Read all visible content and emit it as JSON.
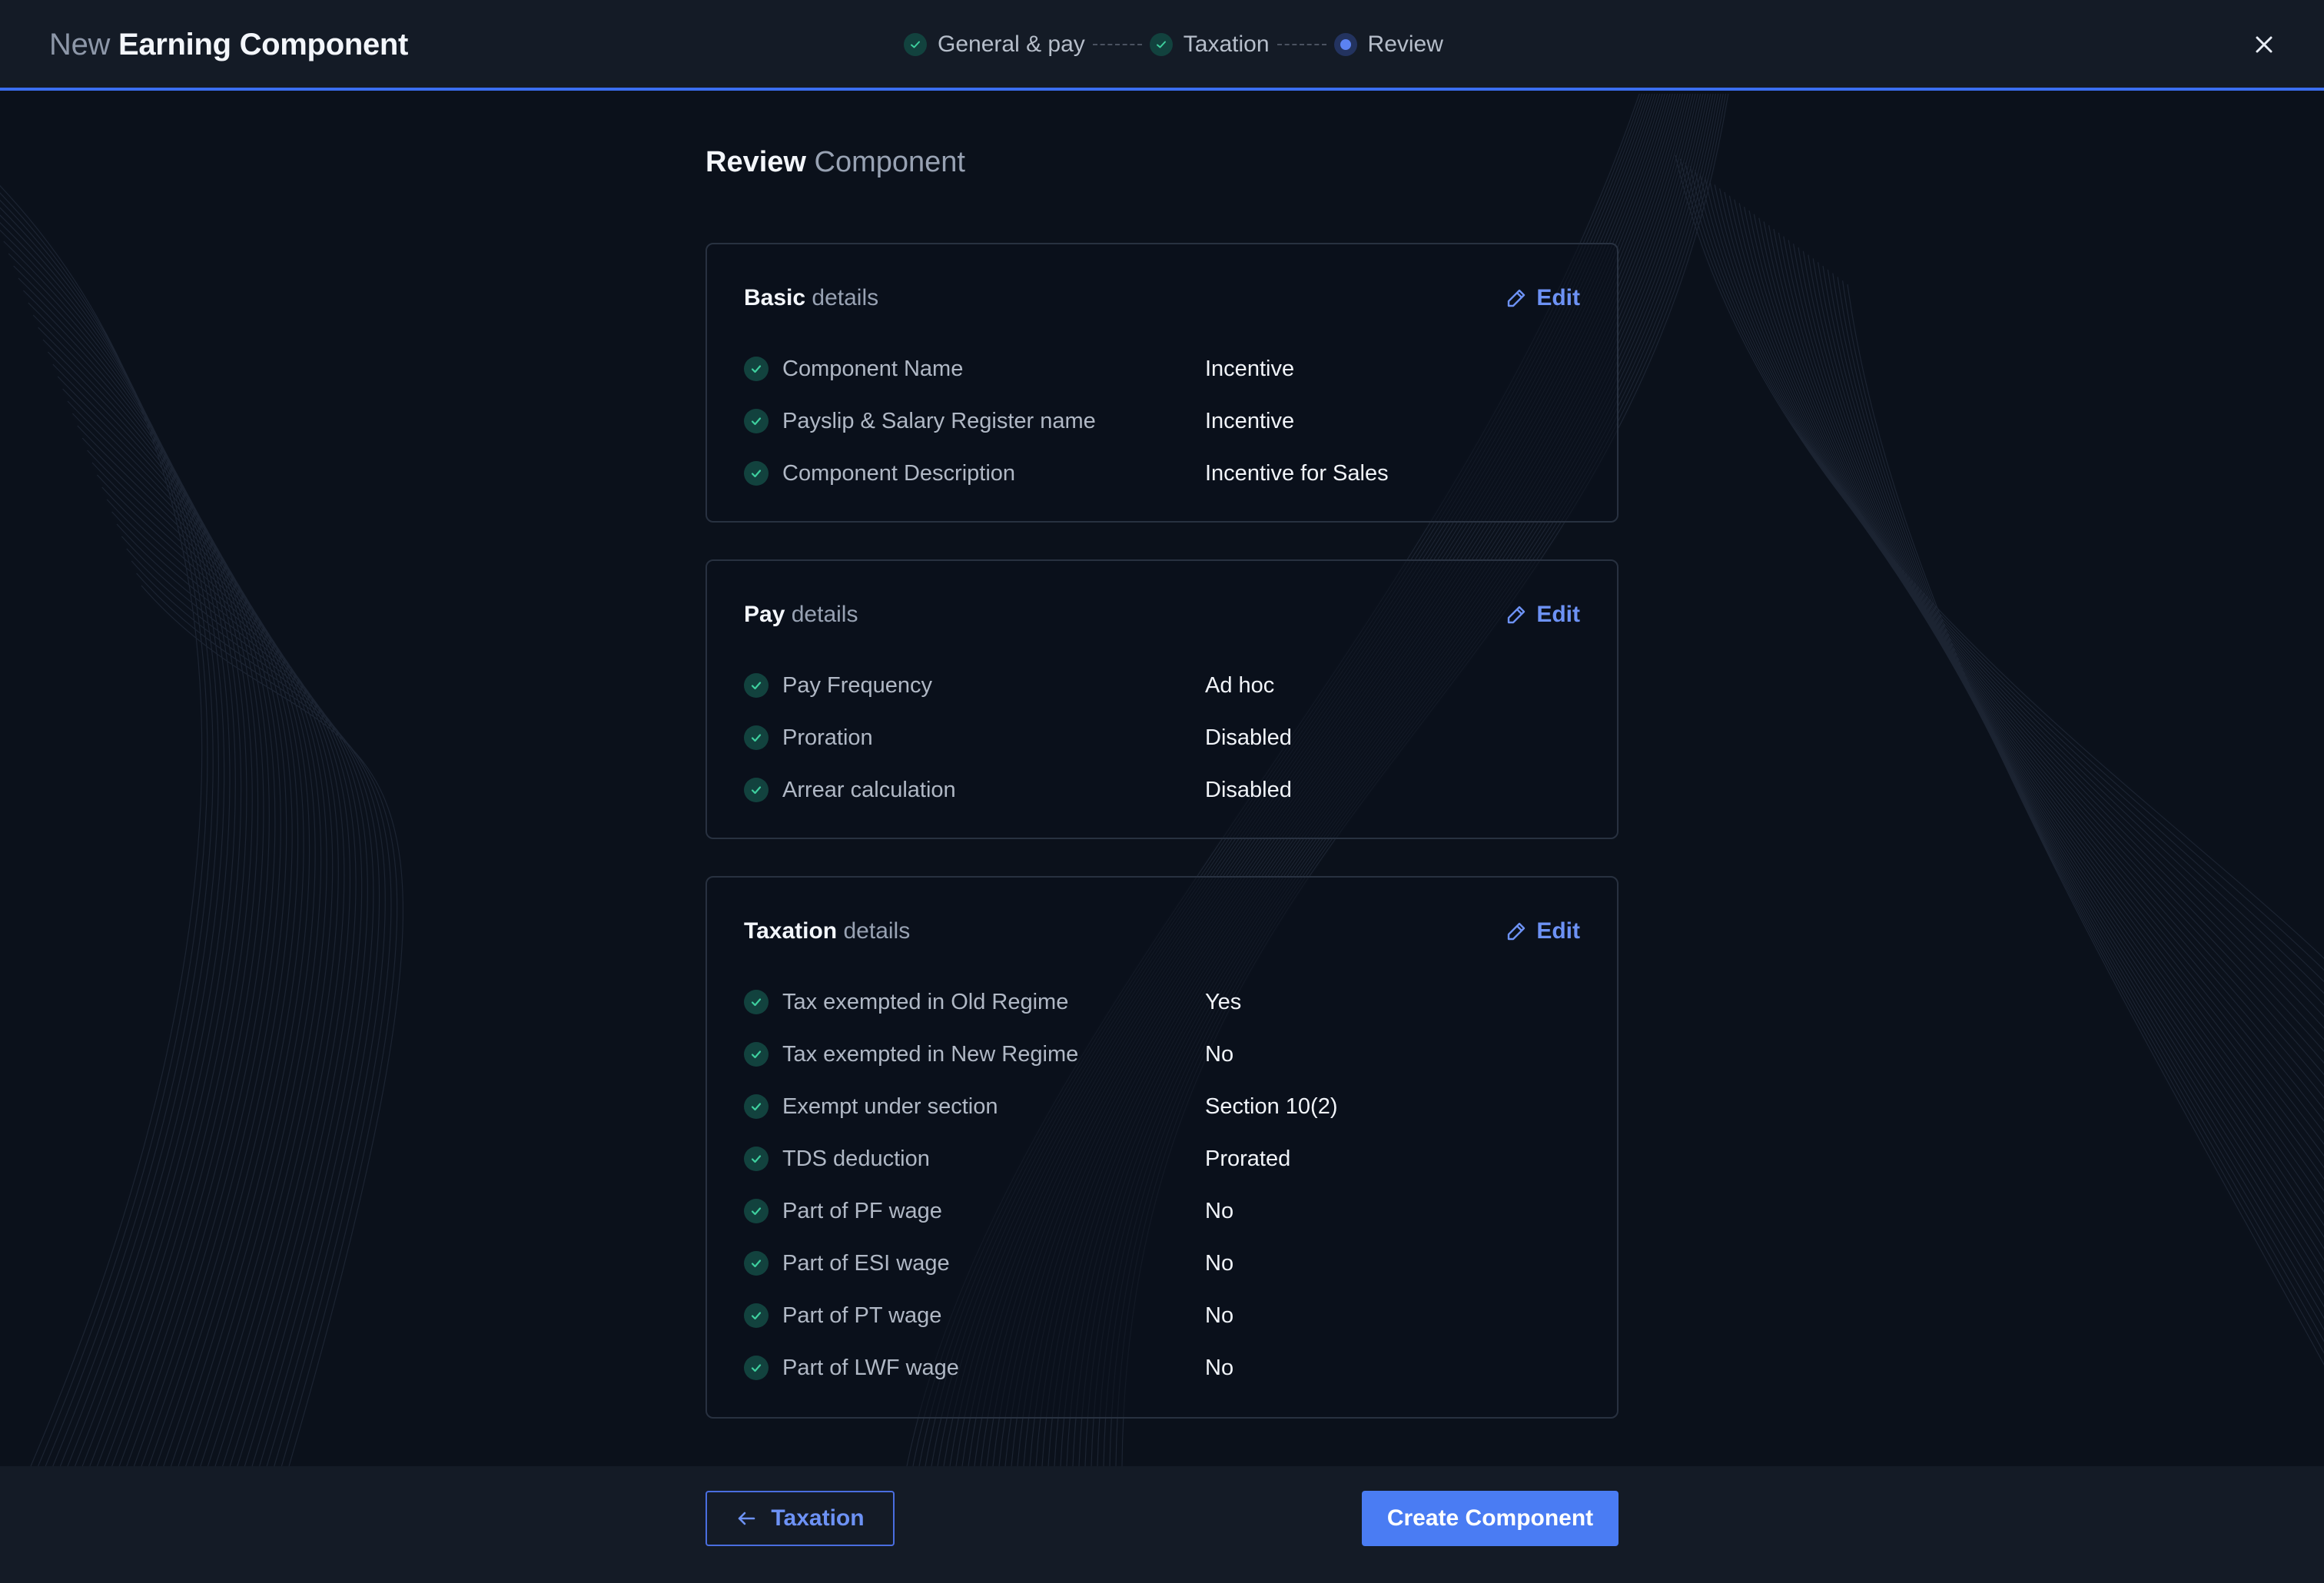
{
  "header": {
    "title_prefix": "New",
    "title_main": "Earning Component",
    "steps": [
      {
        "label": "General & pay",
        "status": "complete"
      },
      {
        "label": "Taxation",
        "status": "complete"
      },
      {
        "label": "Review",
        "status": "current"
      }
    ],
    "close_icon": "close-icon"
  },
  "page": {
    "heading_bold": "Review",
    "heading_light": "Component"
  },
  "sections": [
    {
      "title_bold": "Basic",
      "title_light": "details",
      "edit_label": "Edit",
      "rows": [
        {
          "label": "Component Name",
          "value": "Incentive"
        },
        {
          "label": "Payslip & Salary Register name",
          "value": "Incentive"
        },
        {
          "label": "Component Description",
          "value": "Incentive for Sales"
        }
      ]
    },
    {
      "title_bold": "Pay",
      "title_light": "details",
      "edit_label": "Edit",
      "rows": [
        {
          "label": "Pay Frequency",
          "value": "Ad hoc"
        },
        {
          "label": "Proration",
          "value": "Disabled"
        },
        {
          "label": "Arrear calculation",
          "value": "Disabled"
        }
      ]
    },
    {
      "title_bold": "Taxation",
      "title_light": "details",
      "edit_label": "Edit",
      "rows": [
        {
          "label": "Tax exempted in Old Regime",
          "value": "Yes"
        },
        {
          "label": "Tax exempted in New Regime",
          "value": "No"
        },
        {
          "label": "Exempt under section",
          "value": "Section 10(2)"
        },
        {
          "label": "TDS deduction",
          "value": "Prorated"
        },
        {
          "label": "Part of PF wage",
          "value": "No"
        },
        {
          "label": "Part of ESI wage",
          "value": "No"
        },
        {
          "label": "Part of PT wage",
          "value": "No"
        },
        {
          "label": "Part of LWF wage",
          "value": "No"
        }
      ]
    }
  ],
  "footer": {
    "back_label": "Taxation",
    "create_label": "Create Component"
  },
  "colors": {
    "accent": "#4a7cf3",
    "background": "#0b111b",
    "bar": "#141b26",
    "success": "#12423e"
  }
}
